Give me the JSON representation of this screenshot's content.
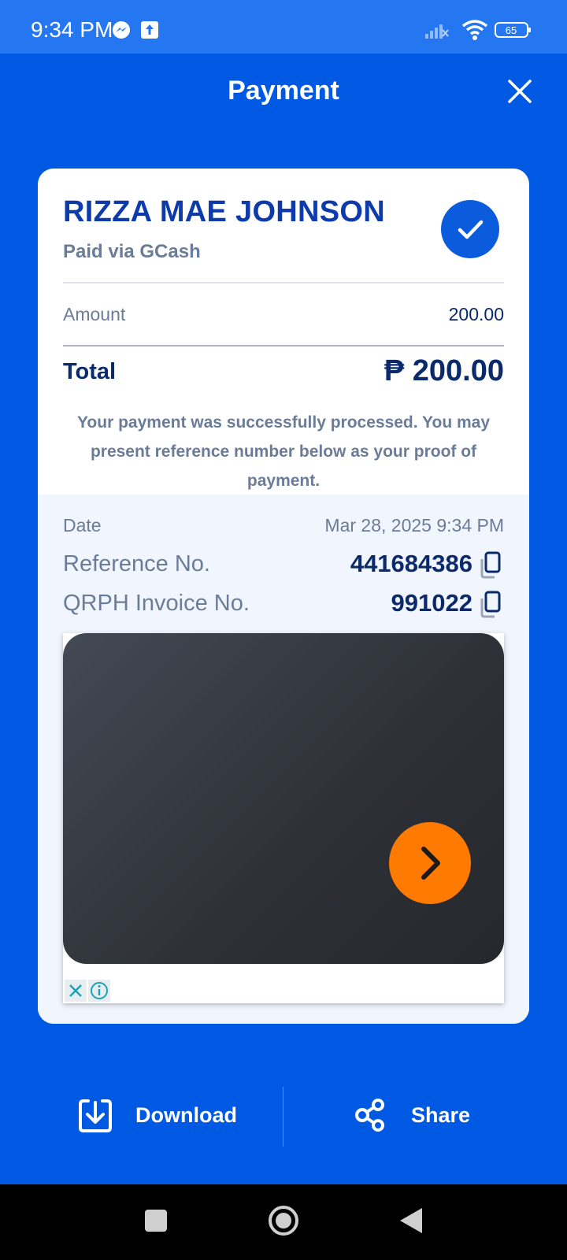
{
  "status_bar": {
    "time": "9:34 PM",
    "battery": "65",
    "icons": [
      "messenger-icon",
      "upload-icon",
      "signal-icon",
      "wifi-icon",
      "battery-icon"
    ]
  },
  "header": {
    "title": "Payment",
    "close_icon": "close-icon"
  },
  "receipt": {
    "payer_name": "RIZZA MAE JOHNSON",
    "paid_via": "Paid via GCash",
    "amount_label": "Amount",
    "amount_value": "200.00",
    "total_label": "Total",
    "total_value": "₱ 200.00",
    "note": "Your payment was successfully processed. You may present reference number below as your proof of payment."
  },
  "details": {
    "date_label": "Date",
    "date_value": "Mar 28, 2025 9:34 PM",
    "reference_label": "Reference No.",
    "reference_value": "441684386",
    "invoice_label": "QRPH Invoice No.",
    "invoice_value": "991022"
  },
  "actions": {
    "download_label": "Download",
    "share_label": "Share"
  },
  "colors": {
    "primary_blue": "#0059e3",
    "status_bar_blue": "#2477f0",
    "accent_orange": "#ff7a00",
    "name_blue": "#0d3bab"
  }
}
